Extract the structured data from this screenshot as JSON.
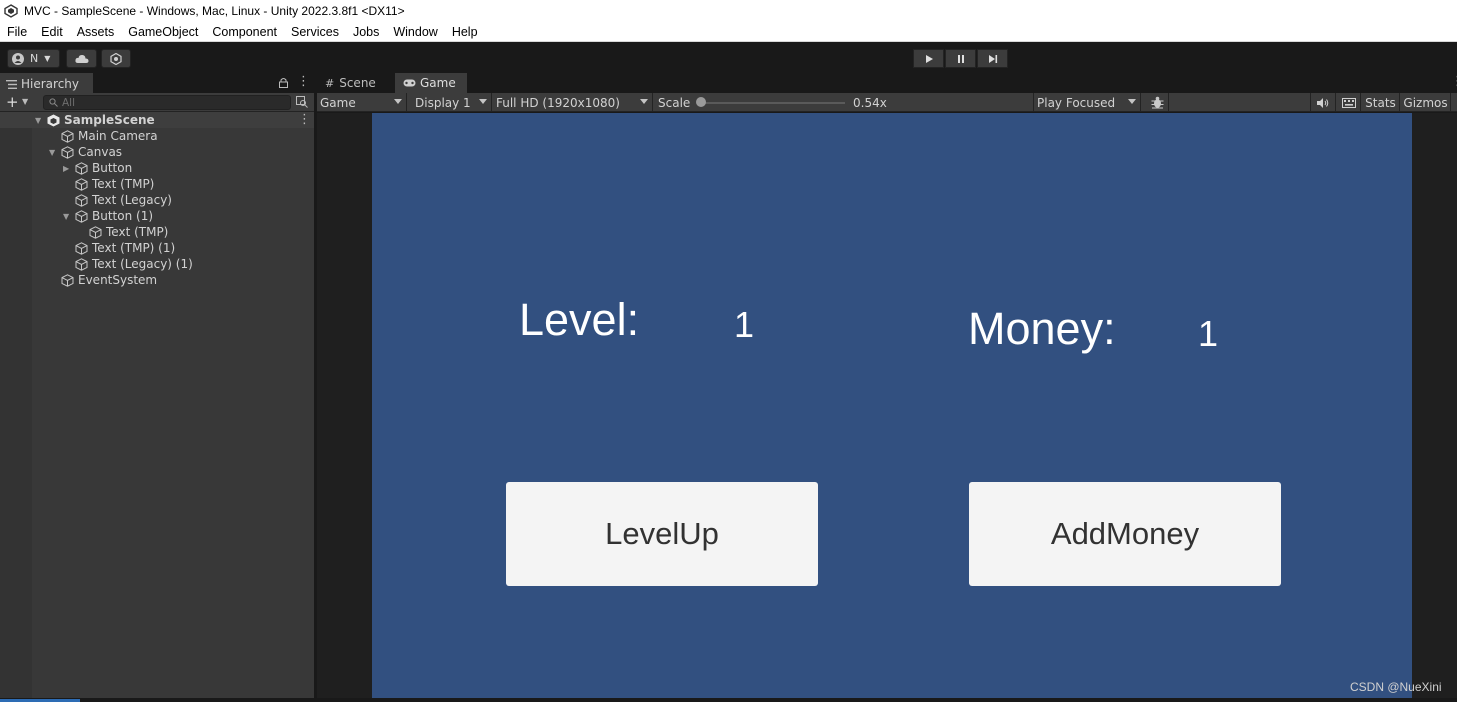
{
  "window": {
    "title": "MVC - SampleScene - Windows, Mac, Linux - Unity 2022.3.8f1 <DX11>"
  },
  "menu": [
    "File",
    "Edit",
    "Assets",
    "GameObject",
    "Component",
    "Services",
    "Jobs",
    "Window",
    "Help"
  ],
  "toolbar": {
    "account_label": "N"
  },
  "hierarchy": {
    "tab_label": "Hierarchy",
    "search_placeholder": "All",
    "scene_name": "SampleScene",
    "items": [
      {
        "label": "Main Camera"
      },
      {
        "label": "Canvas"
      },
      {
        "label": "Button"
      },
      {
        "label": "Text (TMP)"
      },
      {
        "label": "Text (Legacy)"
      },
      {
        "label": "Button (1)"
      },
      {
        "label": "Text (TMP)"
      },
      {
        "label": "Text (TMP) (1)"
      },
      {
        "label": "Text (Legacy) (1)"
      },
      {
        "label": "EventSystem"
      }
    ]
  },
  "game_view": {
    "tabs": [
      {
        "label": "Scene"
      },
      {
        "label": "Game"
      }
    ],
    "active_tab": "Game",
    "mode": "Game",
    "display": "Display 1",
    "resolution": "Full HD (1920x1080)",
    "scale_label": "Scale",
    "scale_value": "0.54x",
    "play_mode": "Play Focused",
    "stats_label": "Stats",
    "gizmos_label": "Gizmos"
  },
  "game": {
    "level_label": "Level:",
    "level_value": "1",
    "money_label": "Money:",
    "money_value": "1",
    "levelup_button": "LevelUp",
    "addmoney_button": "AddMoney"
  },
  "watermark": "CSDN @NueXini",
  "colors": {
    "game_background": "#325080",
    "button_face": "#f4f4f4",
    "editor_dark": "#191919",
    "panel": "#383838"
  }
}
